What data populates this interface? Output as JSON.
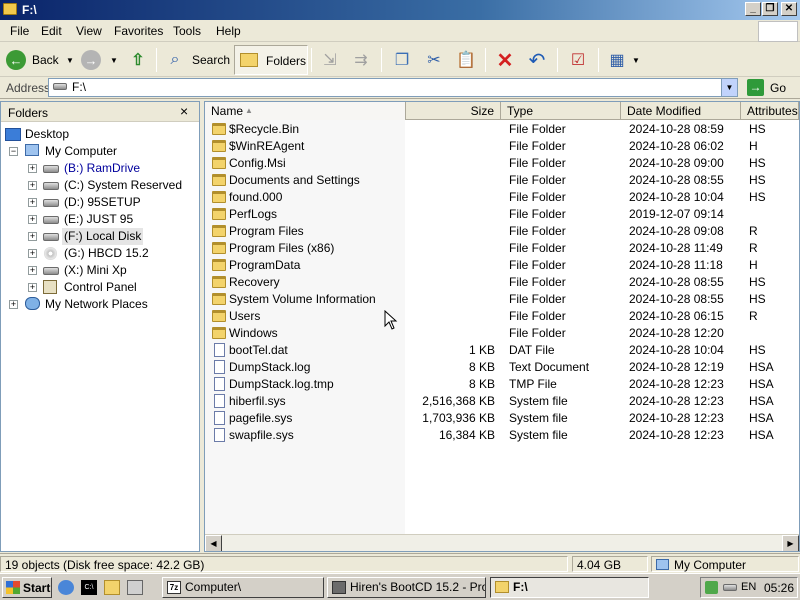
{
  "window": {
    "title": "F:\\"
  },
  "menu": [
    "File",
    "Edit",
    "View",
    "Favorites",
    "Tools",
    "Help"
  ],
  "toolbar": {
    "back_label": "Back",
    "search_label": "Search",
    "folders_label": "Folders"
  },
  "address": {
    "label": "Address",
    "value": "F:\\",
    "go_label": "Go"
  },
  "folders_pane": {
    "title": "Folders",
    "close": "×",
    "tree": [
      {
        "label": "Desktop",
        "icon": "desktop-icon"
      },
      {
        "label": "My Computer",
        "icon": "computer-icon"
      },
      {
        "label": "(B:) RamDrive",
        "icon": "drive-icon"
      },
      {
        "label": "(C:) System Reserved",
        "icon": "drive-icon"
      },
      {
        "label": "(D:) 95SETUP",
        "icon": "drive-icon"
      },
      {
        "label": "(E:) JUST 95",
        "icon": "drive-icon"
      },
      {
        "label": "(F:) Local Disk",
        "icon": "drive-icon"
      },
      {
        "label": "(G:) HBCD 15.2",
        "icon": "cd-drive-icon"
      },
      {
        "label": "(X:) Mini Xp",
        "icon": "drive-icon"
      },
      {
        "label": "Control Panel",
        "icon": "control-panel-icon"
      },
      {
        "label": "My Network Places",
        "icon": "network-icon"
      }
    ]
  },
  "list": {
    "columns": [
      "Name",
      "Size",
      "Type",
      "Date Modified",
      "Attributes"
    ],
    "rows": [
      {
        "name": "$Recycle.Bin",
        "size": "",
        "type": "File Folder",
        "date": "2024-10-28 08:59",
        "attr": "HS",
        "kind": "folder"
      },
      {
        "name": "$WinREAgent",
        "size": "",
        "type": "File Folder",
        "date": "2024-10-28 06:02",
        "attr": "H",
        "kind": "folder"
      },
      {
        "name": "Config.Msi",
        "size": "",
        "type": "File Folder",
        "date": "2024-10-28 09:00",
        "attr": "HS",
        "kind": "folder"
      },
      {
        "name": "Documents and Settings",
        "size": "",
        "type": "File Folder",
        "date": "2024-10-28 08:55",
        "attr": "HS",
        "kind": "folder"
      },
      {
        "name": "found.000",
        "size": "",
        "type": "File Folder",
        "date": "2024-10-28 10:04",
        "attr": "HS",
        "kind": "folder"
      },
      {
        "name": "PerfLogs",
        "size": "",
        "type": "File Folder",
        "date": "2019-12-07 09:14",
        "attr": "",
        "kind": "folder"
      },
      {
        "name": "Program Files",
        "size": "",
        "type": "File Folder",
        "date": "2024-10-28 09:08",
        "attr": "R",
        "kind": "folder"
      },
      {
        "name": "Program Files (x86)",
        "size": "",
        "type": "File Folder",
        "date": "2024-10-28 11:49",
        "attr": "R",
        "kind": "folder"
      },
      {
        "name": "ProgramData",
        "size": "",
        "type": "File Folder",
        "date": "2024-10-28 11:18",
        "attr": "H",
        "kind": "folder"
      },
      {
        "name": "Recovery",
        "size": "",
        "type": "File Folder",
        "date": "2024-10-28 08:55",
        "attr": "HS",
        "kind": "folder"
      },
      {
        "name": "System Volume Information",
        "size": "",
        "type": "File Folder",
        "date": "2024-10-28 08:55",
        "attr": "HS",
        "kind": "folder"
      },
      {
        "name": "Users",
        "size": "",
        "type": "File Folder",
        "date": "2024-10-28 06:15",
        "attr": "R",
        "kind": "folder"
      },
      {
        "name": "Windows",
        "size": "",
        "type": "File Folder",
        "date": "2024-10-28 12:20",
        "attr": "",
        "kind": "folder"
      },
      {
        "name": "bootTel.dat",
        "size": "1 KB",
        "type": "DAT File",
        "date": "2024-10-28 10:04",
        "attr": "HS",
        "kind": "file"
      },
      {
        "name": "DumpStack.log",
        "size": "8 KB",
        "type": "Text Document",
        "date": "2024-10-28 12:19",
        "attr": "HSA",
        "kind": "file"
      },
      {
        "name": "DumpStack.log.tmp",
        "size": "8 KB",
        "type": "TMP File",
        "date": "2024-10-28 12:23",
        "attr": "HSA",
        "kind": "file"
      },
      {
        "name": "hiberfil.sys",
        "size": "2,516,368 KB",
        "type": "System file",
        "date": "2024-10-28 12:23",
        "attr": "HSA",
        "kind": "file"
      },
      {
        "name": "pagefile.sys",
        "size": "1,703,936 KB",
        "type": "System file",
        "date": "2024-10-28 12:23",
        "attr": "HSA",
        "kind": "file"
      },
      {
        "name": "swapfile.sys",
        "size": "16,384 KB",
        "type": "System file",
        "date": "2024-10-28 12:23",
        "attr": "HSA",
        "kind": "file"
      }
    ]
  },
  "statusbar": {
    "objects": "19 objects (Disk free space: 42.2 GB)",
    "size": "4.04 GB",
    "location": "My Computer"
  },
  "taskbar": {
    "start_label": "Start",
    "tasks": [
      "Computer\\",
      "Hiren's BootCD 15.2 - Pro...",
      "F:\\"
    ],
    "lang": "EN",
    "clock": "05:26"
  }
}
